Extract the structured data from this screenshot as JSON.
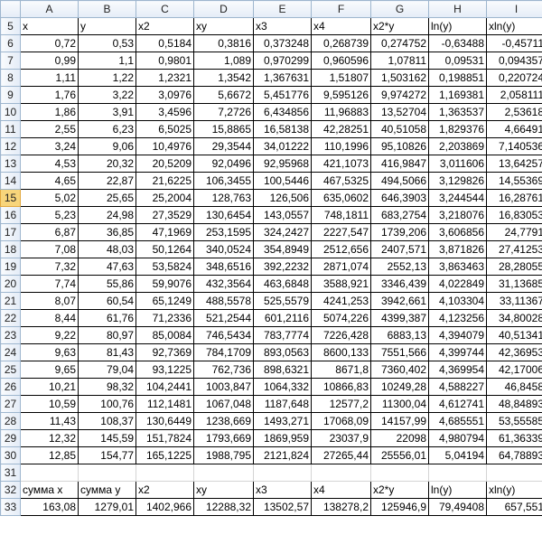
{
  "columns": [
    "A",
    "B",
    "C",
    "D",
    "E",
    "F",
    "G",
    "H",
    "I"
  ],
  "active_row": "15",
  "header_row": {
    "row": "5",
    "cells": [
      "x",
      "y",
      "x2",
      "xy",
      "x3",
      "x4",
      "x2*y",
      "ln(y)",
      "xln(y)"
    ]
  },
  "data_rows": [
    {
      "row": "6",
      "cells": [
        "0,72",
        "0,53",
        "0,5184",
        "0,3816",
        "0,373248",
        "0,268739",
        "0,274752",
        "-0,63488",
        "-0,45711"
      ]
    },
    {
      "row": "7",
      "cells": [
        "0,99",
        "1,1",
        "0,9801",
        "1,089",
        "0,970299",
        "0,960596",
        "1,07811",
        "0,09531",
        "0,094357"
      ]
    },
    {
      "row": "8",
      "cells": [
        "1,11",
        "1,22",
        "1,2321",
        "1,3542",
        "1,367631",
        "1,51807",
        "1,503162",
        "0,198851",
        "0,220724"
      ]
    },
    {
      "row": "9",
      "cells": [
        "1,76",
        "3,22",
        "3,0976",
        "5,6672",
        "5,451776",
        "9,595126",
        "9,974272",
        "1,169381",
        "2,058111"
      ]
    },
    {
      "row": "10",
      "cells": [
        "1,86",
        "3,91",
        "3,4596",
        "7,2726",
        "6,434856",
        "11,96883",
        "13,52704",
        "1,363537",
        "2,53618"
      ]
    },
    {
      "row": "11",
      "cells": [
        "2,55",
        "6,23",
        "6,5025",
        "15,8865",
        "16,58138",
        "42,28251",
        "40,51058",
        "1,829376",
        "4,66491"
      ]
    },
    {
      "row": "12",
      "cells": [
        "3,24",
        "9,06",
        "10,4976",
        "29,3544",
        "34,01222",
        "110,1996",
        "95,10826",
        "2,203869",
        "7,140536"
      ]
    },
    {
      "row": "13",
      "cells": [
        "4,53",
        "20,32",
        "20,5209",
        "92,0496",
        "92,95968",
        "421,1073",
        "416,9847",
        "3,011606",
        "13,64257"
      ]
    },
    {
      "row": "14",
      "cells": [
        "4,65",
        "22,87",
        "21,6225",
        "106,3455",
        "100,5446",
        "467,5325",
        "494,5066",
        "3,129826",
        "14,55369"
      ]
    },
    {
      "row": "15",
      "cells": [
        "5,02",
        "25,65",
        "25,2004",
        "128,763",
        "126,506",
        "635,0602",
        "646,3903",
        "3,244544",
        "16,28761"
      ]
    },
    {
      "row": "16",
      "cells": [
        "5,23",
        "24,98",
        "27,3529",
        "130,6454",
        "143,0557",
        "748,1811",
        "683,2754",
        "3,218076",
        "16,83053"
      ]
    },
    {
      "row": "17",
      "cells": [
        "6,87",
        "36,85",
        "47,1969",
        "253,1595",
        "324,2427",
        "2227,547",
        "1739,206",
        "3,606856",
        "24,7791"
      ]
    },
    {
      "row": "18",
      "cells": [
        "7,08",
        "48,03",
        "50,1264",
        "340,0524",
        "354,8949",
        "2512,656",
        "2407,571",
        "3,871826",
        "27,41253"
      ]
    },
    {
      "row": "19",
      "cells": [
        "7,32",
        "47,63",
        "53,5824",
        "348,6516",
        "392,2232",
        "2871,074",
        "2552,13",
        "3,863463",
        "28,28055"
      ]
    },
    {
      "row": "20",
      "cells": [
        "7,74",
        "55,86",
        "59,9076",
        "432,3564",
        "463,6848",
        "3588,921",
        "3346,439",
        "4,022849",
        "31,13685"
      ]
    },
    {
      "row": "21",
      "cells": [
        "8,07",
        "60,54",
        "65,1249",
        "488,5578",
        "525,5579",
        "4241,253",
        "3942,661",
        "4,103304",
        "33,11367"
      ]
    },
    {
      "row": "22",
      "cells": [
        "8,44",
        "61,76",
        "71,2336",
        "521,2544",
        "601,2116",
        "5074,226",
        "4399,387",
        "4,123256",
        "34,80028"
      ]
    },
    {
      "row": "23",
      "cells": [
        "9,22",
        "80,97",
        "85,0084",
        "746,5434",
        "783,7774",
        "7226,428",
        "6883,13",
        "4,394079",
        "40,51341"
      ]
    },
    {
      "row": "24",
      "cells": [
        "9,63",
        "81,43",
        "92,7369",
        "784,1709",
        "893,0563",
        "8600,133",
        "7551,566",
        "4,399744",
        "42,36953"
      ]
    },
    {
      "row": "25",
      "cells": [
        "9,65",
        "79,04",
        "93,1225",
        "762,736",
        "898,6321",
        "8671,8",
        "7360,402",
        "4,369954",
        "42,17006"
      ]
    },
    {
      "row": "26",
      "cells": [
        "10,21",
        "98,32",
        "104,2441",
        "1003,847",
        "1064,332",
        "10866,83",
        "10249,28",
        "4,588227",
        "46,8458"
      ]
    },
    {
      "row": "27",
      "cells": [
        "10,59",
        "100,76",
        "112,1481",
        "1067,048",
        "1187,648",
        "12577,2",
        "11300,04",
        "4,612741",
        "48,84893"
      ]
    },
    {
      "row": "28",
      "cells": [
        "11,43",
        "108,37",
        "130,6449",
        "1238,669",
        "1493,271",
        "17068,09",
        "14157,99",
        "4,685551",
        "53,55585"
      ]
    },
    {
      "row": "29",
      "cells": [
        "12,32",
        "145,59",
        "151,7824",
        "1793,669",
        "1869,959",
        "23037,9",
        "22098",
        "4,980794",
        "61,36339"
      ]
    },
    {
      "row": "30",
      "cells": [
        "12,85",
        "154,77",
        "165,1225",
        "1988,795",
        "2121,824",
        "27265,44",
        "25556,01",
        "5,04194",
        "64,78893"
      ]
    }
  ],
  "empty_row": {
    "row": "31"
  },
  "sum_header_row": {
    "row": "32",
    "cells": [
      "сумма x",
      "сумма y",
      "x2",
      "xy",
      "x3",
      "x4",
      "x2*y",
      "ln(y)",
      "xln(y)"
    ]
  },
  "sum_values_row": {
    "row": "33",
    "cells": [
      "163,08",
      "1279,01",
      "1402,966",
      "12288,32",
      "13502,57",
      "138278,2",
      "125946,9",
      "79,49408",
      "657,551"
    ]
  }
}
